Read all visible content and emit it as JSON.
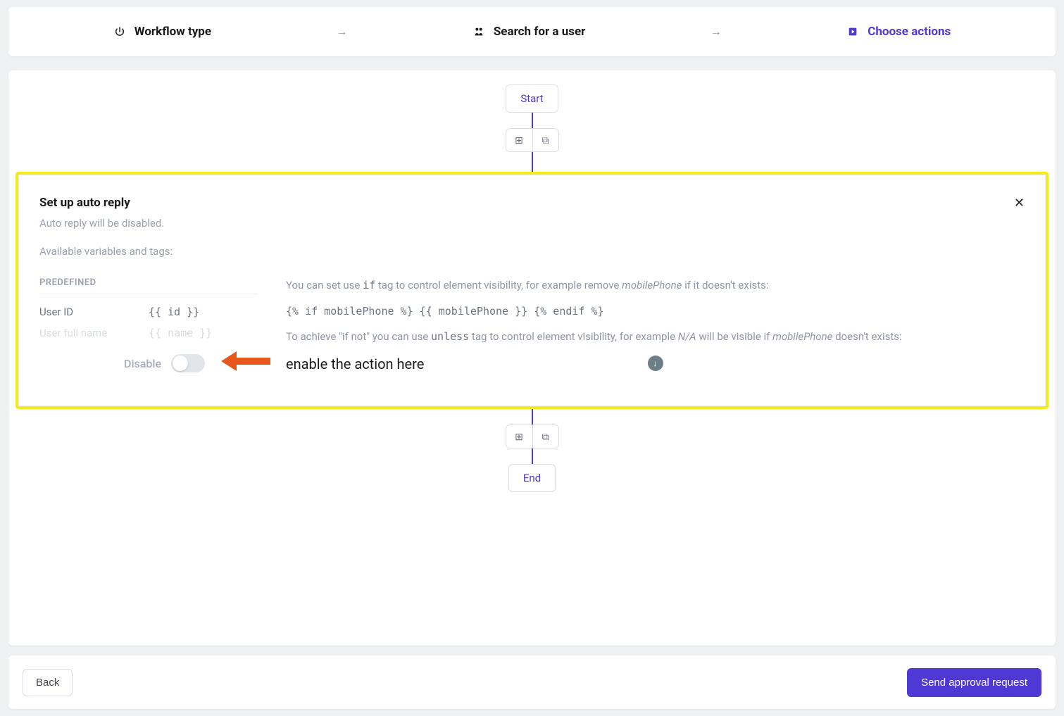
{
  "stepper": {
    "step1": "Workflow type",
    "step2": "Search for a user",
    "step3": "Choose actions"
  },
  "flow": {
    "start": "Start",
    "end": "End"
  },
  "actionCard": {
    "title": "Set up auto reply",
    "subtitle": "Auto reply will be disabled.",
    "availableLabel": "Available variables and tags:",
    "predefinedHeader": "PREDEFINED",
    "vars": [
      {
        "name": "User ID",
        "code": "{{ id }}"
      },
      {
        "name": "User full name",
        "code": "{{ name }}"
      }
    ],
    "help": {
      "line1_pre": "You can set use ",
      "line1_code": "if",
      "line1_mid": " tag to control element visibility, for example remove ",
      "line1_em": "mobilePhone",
      "line1_post": " if it doesn't exists:",
      "codeExample": "{% if mobilePhone %} {{ mobilePhone }} {% endif %}",
      "line2_pre": "To achieve \"if not\" you can use ",
      "line2_code": "unless",
      "line2_mid": " tag to control element visibility, for example ",
      "line2_em1": "N/A",
      "line2_mid2": " will be visible if ",
      "line2_em2": "mobilePhone",
      "line2_post": " doesn't exists:"
    },
    "toggleLabel": "Disable",
    "annotation": "enable the action here"
  },
  "footer": {
    "back": "Back",
    "submit": "Send approval request"
  }
}
